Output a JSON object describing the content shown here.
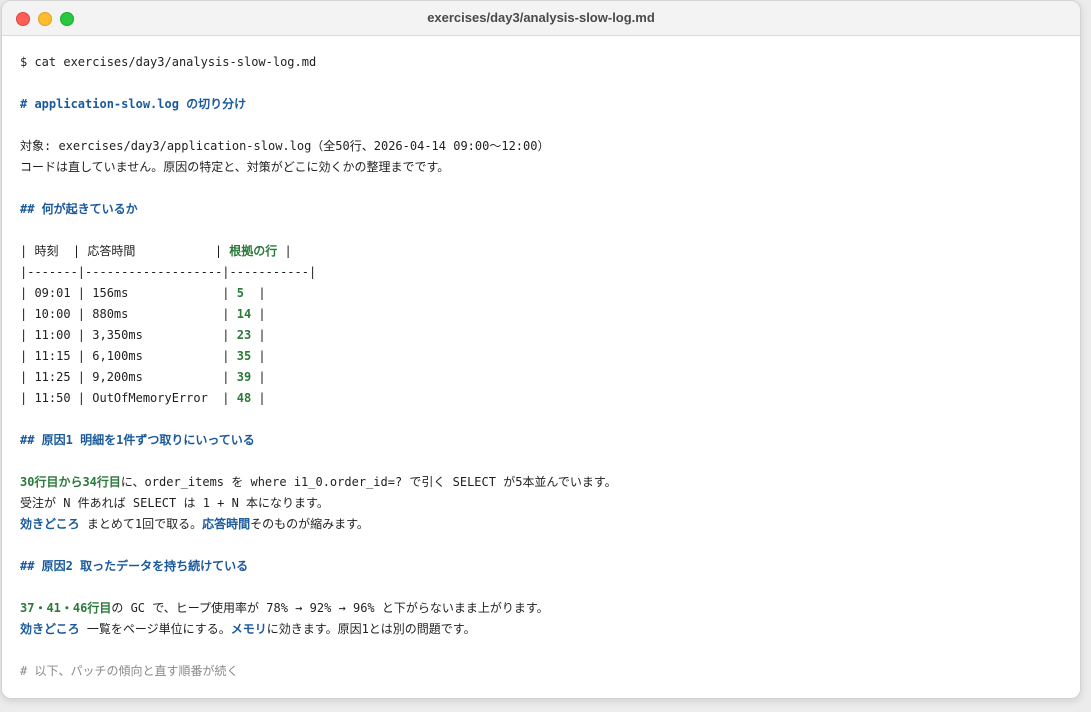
{
  "window": {
    "title": "exercises/day3/analysis-slow-log.md"
  },
  "doc": {
    "command": "$ cat exercises/day3/analysis-slow-log.md",
    "h1": "# application-slow.log の切り分け",
    "target_line": "対象: exercises/day3/application-slow.log（全50行、2026-04-14 09:00〜12:00）",
    "note_line": "コードは直していません。原因の特定と、対策がどこに効くかの整理までです。",
    "h2_what": "## 何が起きているか",
    "table": {
      "header": {
        "c1": "| 時刻  | 応答時間           | ",
        "c2": "根拠の行",
        "c3": " |"
      },
      "separator": "|-------|-------------------|-----------|",
      "rows": [
        {
          "pre": "| 09:01 | 156ms             | ",
          "line": "5",
          "post": "  |"
        },
        {
          "pre": "| 10:00 | 880ms             | ",
          "line": "14",
          "post": " |"
        },
        {
          "pre": "| 11:00 | 3,350ms           | ",
          "line": "23",
          "post": " |"
        },
        {
          "pre": "| 11:15 | 6,100ms           | ",
          "line": "35",
          "post": " |"
        },
        {
          "pre": "| 11:25 | 9,200ms           | ",
          "line": "39",
          "post": " |"
        },
        {
          "pre": "| 11:50 | OutOfMemoryError  | ",
          "line": "48",
          "post": " |"
        }
      ]
    },
    "h2_cause1": "## 原因1 明細を1件ずつ取りにいっている",
    "cause1": {
      "l1_ref": "30行目から34行目",
      "l1_text": "に、order_items を where i1_0.order_id=? で引く SELECT が5本並んでいます。",
      "l2_text": "受注が N 件あれば SELECT は 1 + N 本になります。",
      "l3_label": "効きどころ",
      "l3_mid": " まとめて1回で取る。",
      "l3_emph": "応答時間",
      "l3_tail": "そのものが縮みます。"
    },
    "h2_cause2": "## 原因2 取ったデータを持ち続けている",
    "cause2": {
      "l1_ref": "37・41・46行目",
      "l1_text": "の GC で、ヒープ使用率が 78% → 92% → 96% と下がらないまま上がります。",
      "l2_label": "効きどころ",
      "l2_mid": " 一覧をページ単位にする。",
      "l2_emph": "メモリ",
      "l2_tail": "に効きます。原因1とは別の問題です。"
    },
    "footer_comment": "# 以下、パッチの傾向と直す順番が続く"
  },
  "colors": {
    "heading": "#1a5a9c",
    "line_ref": "#2a7a3a",
    "muted": "#8a8a8a"
  }
}
